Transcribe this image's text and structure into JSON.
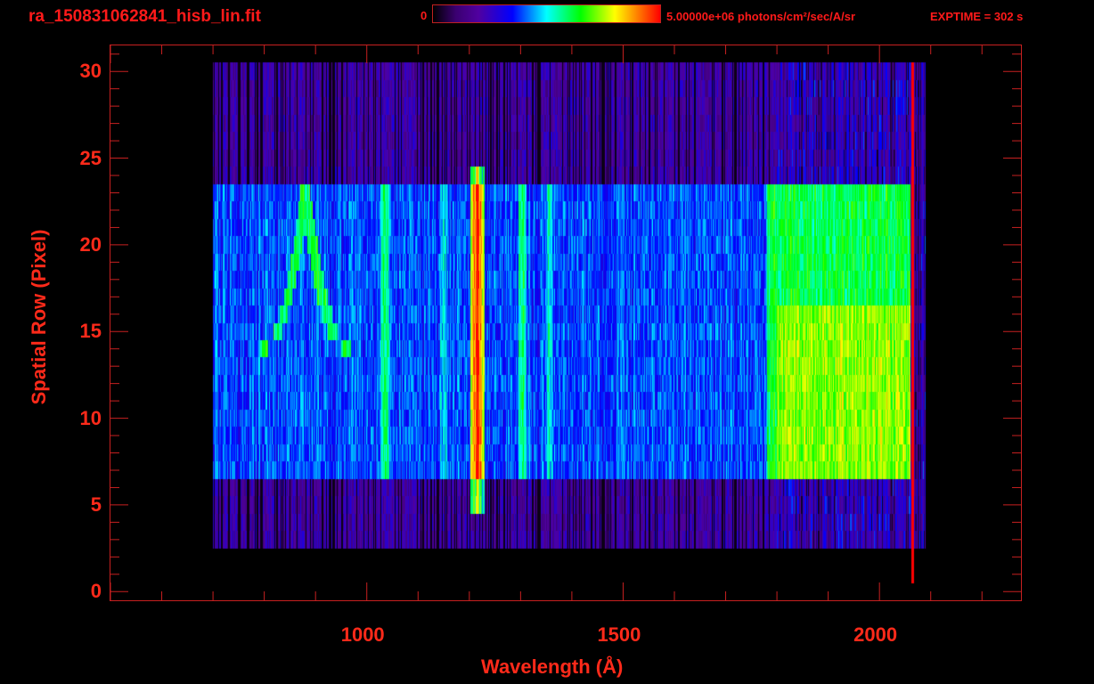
{
  "header": {
    "title": "ra_150831062841_hisb_lin.fit",
    "colorbar_min": "0",
    "colorbar_max": "5.00000e+06 photons/cm²/sec/A/sr",
    "exptime": "EXPTIME = 302 s"
  },
  "chart_data": {
    "type": "heatmap",
    "title": "ra_150831062841_hisb_lin.fit",
    "xlabel": "Wavelength (Å)",
    "ylabel": "Spatial Row (Pixel)",
    "xlim": [
      500,
      2276
    ],
    "ylim": [
      -0.5,
      31.5
    ],
    "x_ticks": [
      "1000",
      "1500",
      "2000"
    ],
    "x_tick_values": [
      1000,
      1500,
      2000
    ],
    "x_minor_step": 100,
    "y_ticks": [
      "0",
      "5",
      "10",
      "15",
      "20",
      "25",
      "30"
    ],
    "y_tick_values": [
      0,
      5,
      10,
      15,
      20,
      25,
      30
    ],
    "y_minor_step": 1,
    "colorbar": {
      "min": 0,
      "max": 5000000,
      "unit": "photons/cm^2/sec/A/sr",
      "colormap": "rainbow"
    },
    "colors": [
      "#000000",
      "#3a0070",
      "#5000a0",
      "#0000ff",
      "#00ffff",
      "#00ff00",
      "#ffff00",
      "#ff0000"
    ],
    "detector_region": {
      "wl_range": [
        700,
        2090
      ],
      "rows": [
        3,
        30
      ]
    },
    "slit_region": {
      "wl_range": [
        700,
        2060
      ],
      "rows": [
        7,
        23
      ],
      "level": 0.32
    },
    "continuum_boost": [
      {
        "wl_range": [
          1780,
          2060
        ],
        "rows": [
          7,
          23
        ],
        "add": 0.22
      },
      {
        "wl_range": [
          1800,
          2060
        ],
        "rows": [
          7,
          16
        ],
        "add": 0.12
      }
    ],
    "emission_lines": [
      {
        "wl": 1216,
        "width": 14,
        "rows": [
          5,
          24
        ],
        "add": 0.62
      },
      {
        "wl": 1035,
        "width": 9,
        "rows": [
          7,
          23
        ],
        "add": 0.22
      },
      {
        "wl": 1304,
        "width": 8,
        "rows": [
          7,
          23
        ],
        "add": 0.2
      },
      {
        "wl": 1356,
        "width": 6,
        "rows": [
          7,
          23
        ],
        "add": 0.14
      },
      {
        "wl": 1150,
        "width": 8,
        "rows": [
          7,
          23
        ],
        "add": 0.1
      }
    ],
    "arc_feature": {
      "wl_start": 800,
      "wl_peak": 880,
      "wl_end": 960,
      "rows": [
        14,
        23
      ],
      "add": 0.22
    },
    "edge_line": {
      "wl": 2065,
      "rows": [
        1,
        30
      ],
      "value": 1.0
    }
  }
}
